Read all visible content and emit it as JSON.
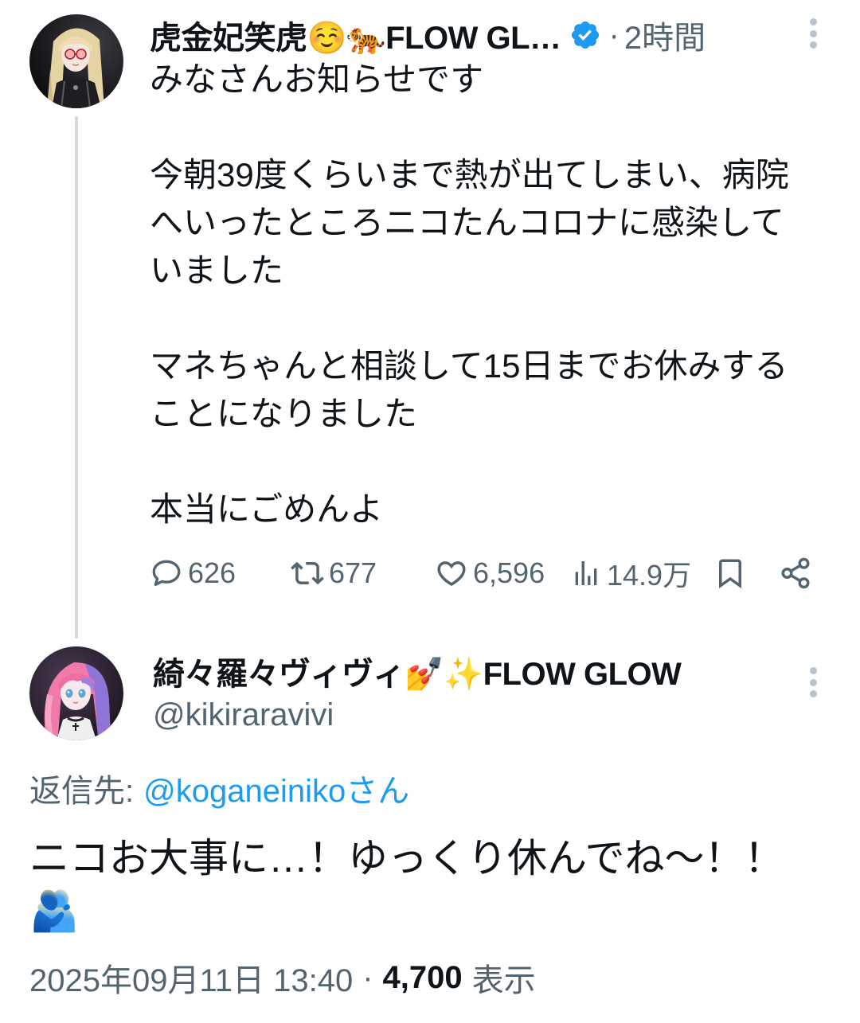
{
  "parent_tweet": {
    "display_name": "虎金妃笑虎☺️🐅FLOW GL…",
    "verified": true,
    "separator": "·",
    "relative_time": "2時間",
    "paragraphs": [
      [
        "みなさんお知らせです"
      ],
      [
        "今朝39度くらいまで熱が出てしまい、病院",
        "へいったところニコたんコロナに感染して",
        "いました"
      ],
      [
        "マネちゃんと相談して15日までお休みする",
        "ことになりました"
      ],
      [
        "本当にごめんよ"
      ]
    ],
    "metrics": {
      "replies": "626",
      "retweets": "677",
      "likes": "6,596",
      "views": "14.9万"
    }
  },
  "focused_reply": {
    "display_name": "綺々羅々ヴィヴィ💅✨FLOW GLOW",
    "handle": "@kikiraravivi",
    "reply_to_label": "返信先:",
    "reply_to_handle": "@koganeinikoさん",
    "text_lines": [
      "ニコお大事に…！ゆっくり休んでね〜！！",
      "🫂"
    ],
    "timestamp": "2025年09月11日 13:40",
    "separator": "·",
    "view_count": "4,700",
    "view_label": "表示"
  },
  "icons": {
    "verified": "verified-badge-icon",
    "more": "more-vertical-icon",
    "reply": "reply-icon",
    "retweet": "retweet-icon",
    "like": "heart-icon",
    "views": "views-icon",
    "bookmark": "bookmark-icon",
    "share": "share-icon"
  },
  "colors": {
    "text_primary": "#0f1419",
    "text_secondary": "#536471",
    "link": "#1d9bf0",
    "thread_line": "#cfd9de",
    "background": "#ffffff",
    "verified_badge": "#1d9bf0"
  }
}
